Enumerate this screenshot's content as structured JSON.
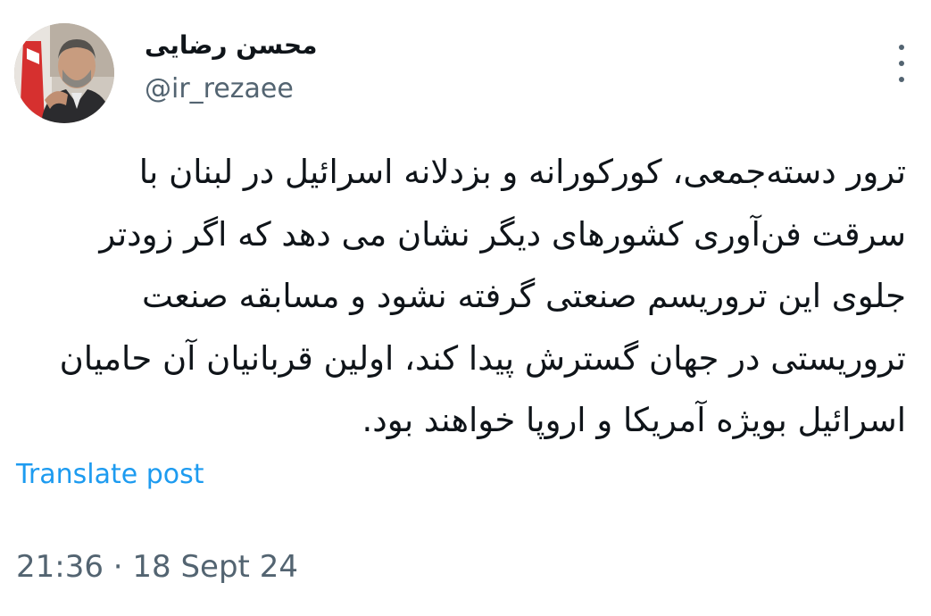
{
  "tweet": {
    "author_name": "محسن رضایی",
    "author_handle": "@ir_rezaee",
    "more_icon": "more-vertical-icon",
    "text": "ترور دسته‌جمعی، کورکورانه و بزدلانه اسرائیل در لبنان با\nسرقت فن‌آوری کشورهای دیگر نشان می دهد که اگر زودتر\nجلوی این تروریسم صنعتی گرفته نشود و مسابقه صنعت\nتروریستی در جهان گسترش پیدا کند، اولین قربانیان آن حامیان\nاسرائیل بویژه آمریکا و اروپا خواهند بود.",
    "translate_label": "Translate post",
    "timestamp": "21:36 · 18 Sept 24"
  },
  "colors": {
    "text_primary": "#0f1419",
    "text_secondary": "#536471",
    "link": "#1d9bf0",
    "background": "#ffffff"
  }
}
